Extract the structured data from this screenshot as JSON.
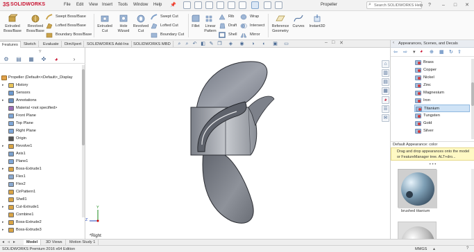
{
  "app": {
    "brand_ds": "3S",
    "brand_name": "SOLIDWORKS"
  },
  "menubar": {
    "items": [
      "File",
      "Edit",
      "View",
      "Insert",
      "Tools",
      "Window",
      "Help"
    ]
  },
  "title": {
    "document": "Propeller"
  },
  "search": {
    "placeholder": "Search SOLIDWORKS Help"
  },
  "window_controls": {
    "help": "?",
    "minimize": "–",
    "restore": "□",
    "close": "✕"
  },
  "ribbon": {
    "large_buttons": [
      {
        "label": "Extruded Boss/Base"
      },
      {
        "label": "Revolved Boss/Base"
      },
      {
        "label": "Extruded Cut"
      },
      {
        "label": "Hole Wizard"
      },
      {
        "label": "Revolved Cut"
      },
      {
        "label": "Fillet"
      },
      {
        "label": "Linear Pattern"
      },
      {
        "label": "Reference Geometry"
      },
      {
        "label": "Curves"
      },
      {
        "label": "Instant3D"
      }
    ],
    "small_buttons": [
      {
        "label": "Swept Boss/Base"
      },
      {
        "label": "Lofted Boss/Base"
      },
      {
        "label": "Boundary Boss/Base"
      },
      {
        "label": "Swept Cut"
      },
      {
        "label": "Lofted Cut"
      },
      {
        "label": "Boundary Cut"
      },
      {
        "label": "Rib"
      },
      {
        "label": "Draft"
      },
      {
        "label": "Shell"
      },
      {
        "label": "Wrap"
      },
      {
        "label": "Intersect"
      },
      {
        "label": "Mirror"
      }
    ]
  },
  "command_tabs": [
    "Features",
    "Sketch",
    "Evaluate",
    "DimXpert",
    "SOLIDWORKS Add-Ins",
    "SOLIDWORKS MBD"
  ],
  "feature_tree": {
    "root": "Propeller (Default<<Default>_Display",
    "items": [
      {
        "label": "History",
        "expand": "▸"
      },
      {
        "label": "Sensors",
        "expand": ""
      },
      {
        "label": "Annotations",
        "expand": "▸"
      },
      {
        "label": "Material <not specified>",
        "expand": ""
      },
      {
        "label": "Front Plane",
        "expand": ""
      },
      {
        "label": "Top Plane",
        "expand": ""
      },
      {
        "label": "Right Plane",
        "expand": ""
      },
      {
        "label": "Origin",
        "expand": ""
      },
      {
        "label": "Revolve1",
        "expand": "▸"
      },
      {
        "label": "Axis1",
        "expand": ""
      },
      {
        "label": "Plane1",
        "expand": ""
      },
      {
        "label": "Boss-Extrude1",
        "expand": "▸"
      },
      {
        "label": "Flex1",
        "expand": ""
      },
      {
        "label": "Flex2",
        "expand": ""
      },
      {
        "label": "CirPattern1",
        "expand": ""
      },
      {
        "label": "Shell1",
        "expand": ""
      },
      {
        "label": "Cut-Extrude1",
        "expand": "▸"
      },
      {
        "label": "Combine1",
        "expand": ""
      },
      {
        "label": "Boss-Extrude2",
        "expand": "▸"
      },
      {
        "label": "Boss-Extrude3",
        "expand": "▸"
      }
    ]
  },
  "bottom_tabs": [
    "Model",
    "3D Views",
    "Motion Study 1"
  ],
  "viewport": {
    "orientation": "*Right",
    "axis_x": "X",
    "axis_y": "Y",
    "axis_z": "Z"
  },
  "appearances": {
    "title": "Appearances, Scenes, and Decals",
    "items": [
      "Brass",
      "Copper",
      "Nickel",
      "Zinc",
      "Magnesium",
      "Iron",
      "Titanium",
      "Tungsten",
      "Gold",
      "Silver"
    ],
    "selected": "Titanium",
    "default_label": "Default Appearance: color",
    "hint": "Drag and drop appearances onto the model or FeatureManager tree. ALT+dro...",
    "thumbnails": [
      {
        "label": "brushed titanium"
      }
    ]
  },
  "status": {
    "edition": "SOLIDWORKS Premium 2016 x64 Edition",
    "units": "MMGS"
  },
  "colors": {
    "accent": "#c8102e",
    "selection": "#cfe3f6",
    "hint_bg": "#fff9c4",
    "part_gray": "#8a8e96"
  }
}
